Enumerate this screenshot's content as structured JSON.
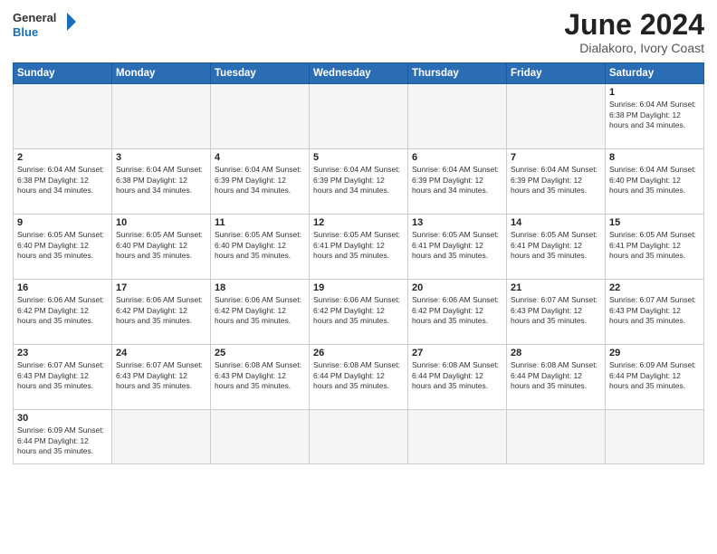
{
  "header": {
    "logo_general": "General",
    "logo_blue": "Blue",
    "month_year": "June 2024",
    "location": "Dialakoro, Ivory Coast"
  },
  "weekdays": [
    "Sunday",
    "Monday",
    "Tuesday",
    "Wednesday",
    "Thursday",
    "Friday",
    "Saturday"
  ],
  "weeks": [
    [
      {
        "day": "",
        "info": ""
      },
      {
        "day": "",
        "info": ""
      },
      {
        "day": "",
        "info": ""
      },
      {
        "day": "",
        "info": ""
      },
      {
        "day": "",
        "info": ""
      },
      {
        "day": "",
        "info": ""
      },
      {
        "day": "1",
        "info": "Sunrise: 6:04 AM\nSunset: 6:38 PM\nDaylight: 12 hours\nand 34 minutes."
      }
    ],
    [
      {
        "day": "2",
        "info": "Sunrise: 6:04 AM\nSunset: 6:38 PM\nDaylight: 12 hours\nand 34 minutes."
      },
      {
        "day": "3",
        "info": "Sunrise: 6:04 AM\nSunset: 6:38 PM\nDaylight: 12 hours\nand 34 minutes."
      },
      {
        "day": "4",
        "info": "Sunrise: 6:04 AM\nSunset: 6:39 PM\nDaylight: 12 hours\nand 34 minutes."
      },
      {
        "day": "5",
        "info": "Sunrise: 6:04 AM\nSunset: 6:39 PM\nDaylight: 12 hours\nand 34 minutes."
      },
      {
        "day": "6",
        "info": "Sunrise: 6:04 AM\nSunset: 6:39 PM\nDaylight: 12 hours\nand 34 minutes."
      },
      {
        "day": "7",
        "info": "Sunrise: 6:04 AM\nSunset: 6:39 PM\nDaylight: 12 hours\nand 35 minutes."
      },
      {
        "day": "8",
        "info": "Sunrise: 6:04 AM\nSunset: 6:40 PM\nDaylight: 12 hours\nand 35 minutes."
      }
    ],
    [
      {
        "day": "9",
        "info": "Sunrise: 6:05 AM\nSunset: 6:40 PM\nDaylight: 12 hours\nand 35 minutes."
      },
      {
        "day": "10",
        "info": "Sunrise: 6:05 AM\nSunset: 6:40 PM\nDaylight: 12 hours\nand 35 minutes."
      },
      {
        "day": "11",
        "info": "Sunrise: 6:05 AM\nSunset: 6:40 PM\nDaylight: 12 hours\nand 35 minutes."
      },
      {
        "day": "12",
        "info": "Sunrise: 6:05 AM\nSunset: 6:41 PM\nDaylight: 12 hours\nand 35 minutes."
      },
      {
        "day": "13",
        "info": "Sunrise: 6:05 AM\nSunset: 6:41 PM\nDaylight: 12 hours\nand 35 minutes."
      },
      {
        "day": "14",
        "info": "Sunrise: 6:05 AM\nSunset: 6:41 PM\nDaylight: 12 hours\nand 35 minutes."
      },
      {
        "day": "15",
        "info": "Sunrise: 6:05 AM\nSunset: 6:41 PM\nDaylight: 12 hours\nand 35 minutes."
      }
    ],
    [
      {
        "day": "16",
        "info": "Sunrise: 6:06 AM\nSunset: 6:42 PM\nDaylight: 12 hours\nand 35 minutes."
      },
      {
        "day": "17",
        "info": "Sunrise: 6:06 AM\nSunset: 6:42 PM\nDaylight: 12 hours\nand 35 minutes."
      },
      {
        "day": "18",
        "info": "Sunrise: 6:06 AM\nSunset: 6:42 PM\nDaylight: 12 hours\nand 35 minutes."
      },
      {
        "day": "19",
        "info": "Sunrise: 6:06 AM\nSunset: 6:42 PM\nDaylight: 12 hours\nand 35 minutes."
      },
      {
        "day": "20",
        "info": "Sunrise: 6:06 AM\nSunset: 6:42 PM\nDaylight: 12 hours\nand 35 minutes."
      },
      {
        "day": "21",
        "info": "Sunrise: 6:07 AM\nSunset: 6:43 PM\nDaylight: 12 hours\nand 35 minutes."
      },
      {
        "day": "22",
        "info": "Sunrise: 6:07 AM\nSunset: 6:43 PM\nDaylight: 12 hours\nand 35 minutes."
      }
    ],
    [
      {
        "day": "23",
        "info": "Sunrise: 6:07 AM\nSunset: 6:43 PM\nDaylight: 12 hours\nand 35 minutes."
      },
      {
        "day": "24",
        "info": "Sunrise: 6:07 AM\nSunset: 6:43 PM\nDaylight: 12 hours\nand 35 minutes."
      },
      {
        "day": "25",
        "info": "Sunrise: 6:08 AM\nSunset: 6:43 PM\nDaylight: 12 hours\nand 35 minutes."
      },
      {
        "day": "26",
        "info": "Sunrise: 6:08 AM\nSunset: 6:44 PM\nDaylight: 12 hours\nand 35 minutes."
      },
      {
        "day": "27",
        "info": "Sunrise: 6:08 AM\nSunset: 6:44 PM\nDaylight: 12 hours\nand 35 minutes."
      },
      {
        "day": "28",
        "info": "Sunrise: 6:08 AM\nSunset: 6:44 PM\nDaylight: 12 hours\nand 35 minutes."
      },
      {
        "day": "29",
        "info": "Sunrise: 6:09 AM\nSunset: 6:44 PM\nDaylight: 12 hours\nand 35 minutes."
      }
    ],
    [
      {
        "day": "30",
        "info": "Sunrise: 6:09 AM\nSunset: 6:44 PM\nDaylight: 12 hours\nand 35 minutes."
      },
      {
        "day": "",
        "info": ""
      },
      {
        "day": "",
        "info": ""
      },
      {
        "day": "",
        "info": ""
      },
      {
        "day": "",
        "info": ""
      },
      {
        "day": "",
        "info": ""
      },
      {
        "day": "",
        "info": ""
      }
    ]
  ]
}
